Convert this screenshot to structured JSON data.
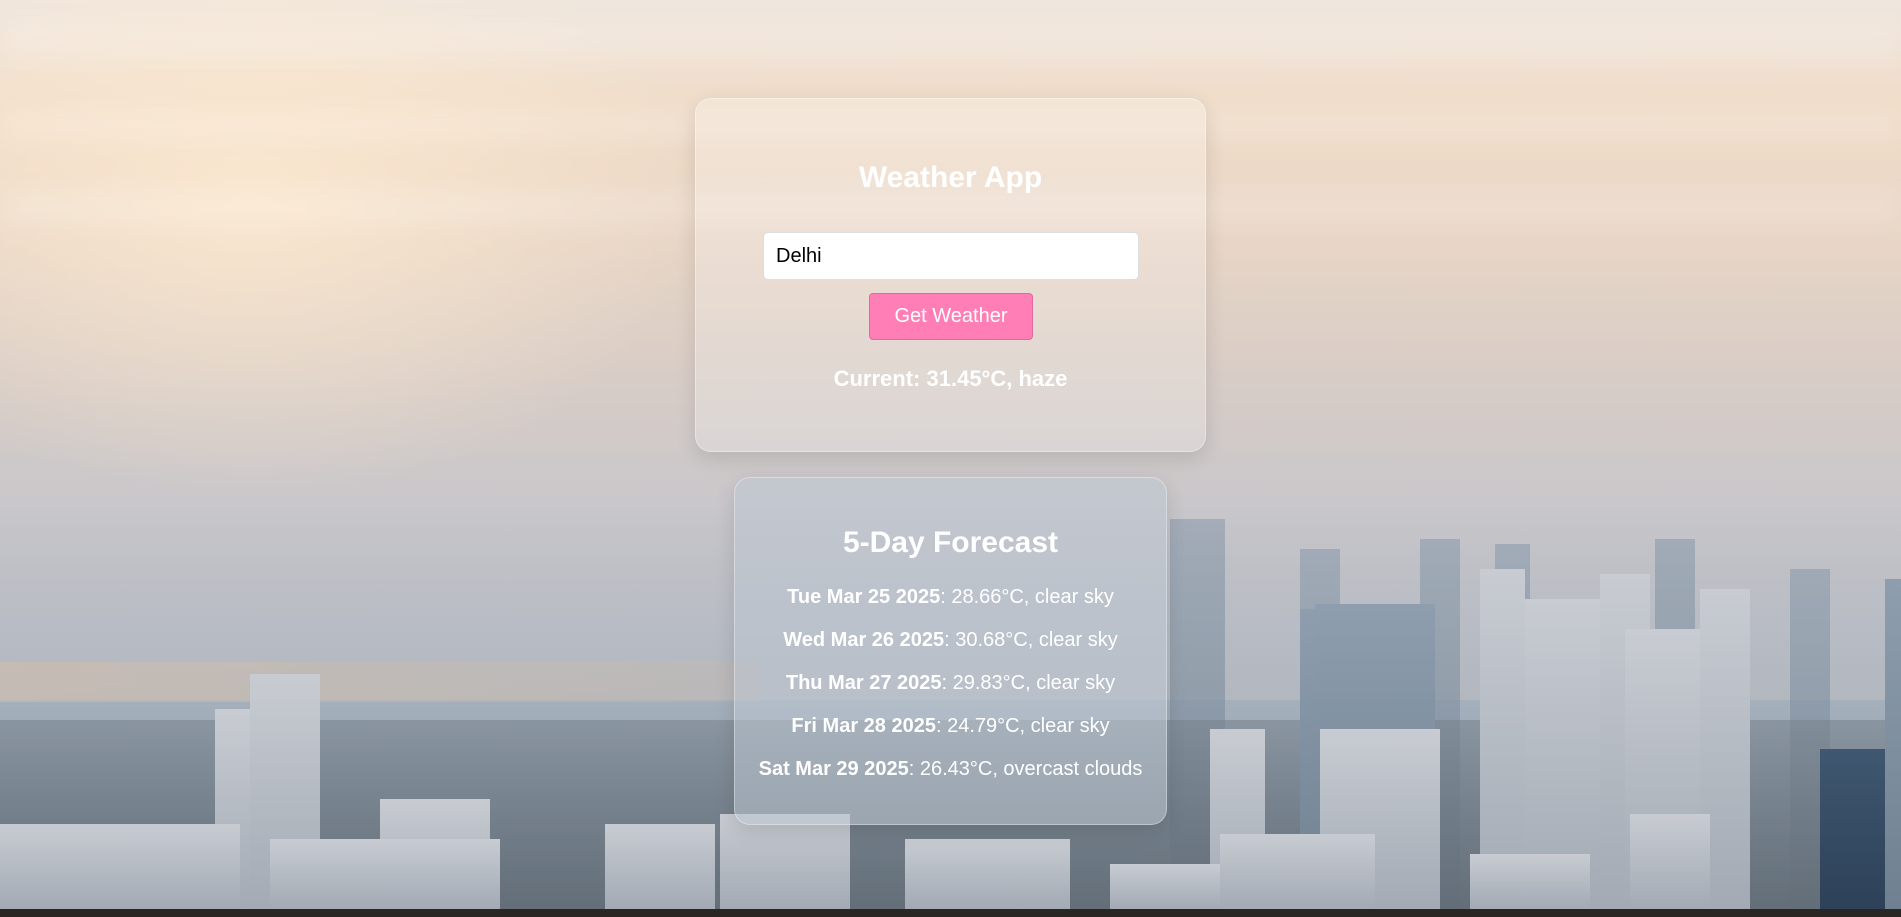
{
  "app": {
    "title": "Weather App"
  },
  "search": {
    "value": "Delhi",
    "button_label": "Get Weather"
  },
  "current": {
    "text": "Current: 31.45°C, haze"
  },
  "forecast": {
    "title": "5-Day Forecast",
    "days": [
      {
        "date": "Tue Mar 25 2025",
        "detail": ": 28.66°C, clear sky"
      },
      {
        "date": "Wed Mar 26 2025",
        "detail": ": 30.68°C, clear sky"
      },
      {
        "date": "Thu Mar 27 2025",
        "detail": ": 29.83°C, clear sky"
      },
      {
        "date": "Fri Mar 28 2025",
        "detail": ": 24.79°C, clear sky"
      },
      {
        "date": "Sat Mar 29 2025",
        "detail": ": 26.43°C, overcast clouds"
      }
    ]
  },
  "colors": {
    "button": "#ff7eb6",
    "text": "#ffffff"
  }
}
